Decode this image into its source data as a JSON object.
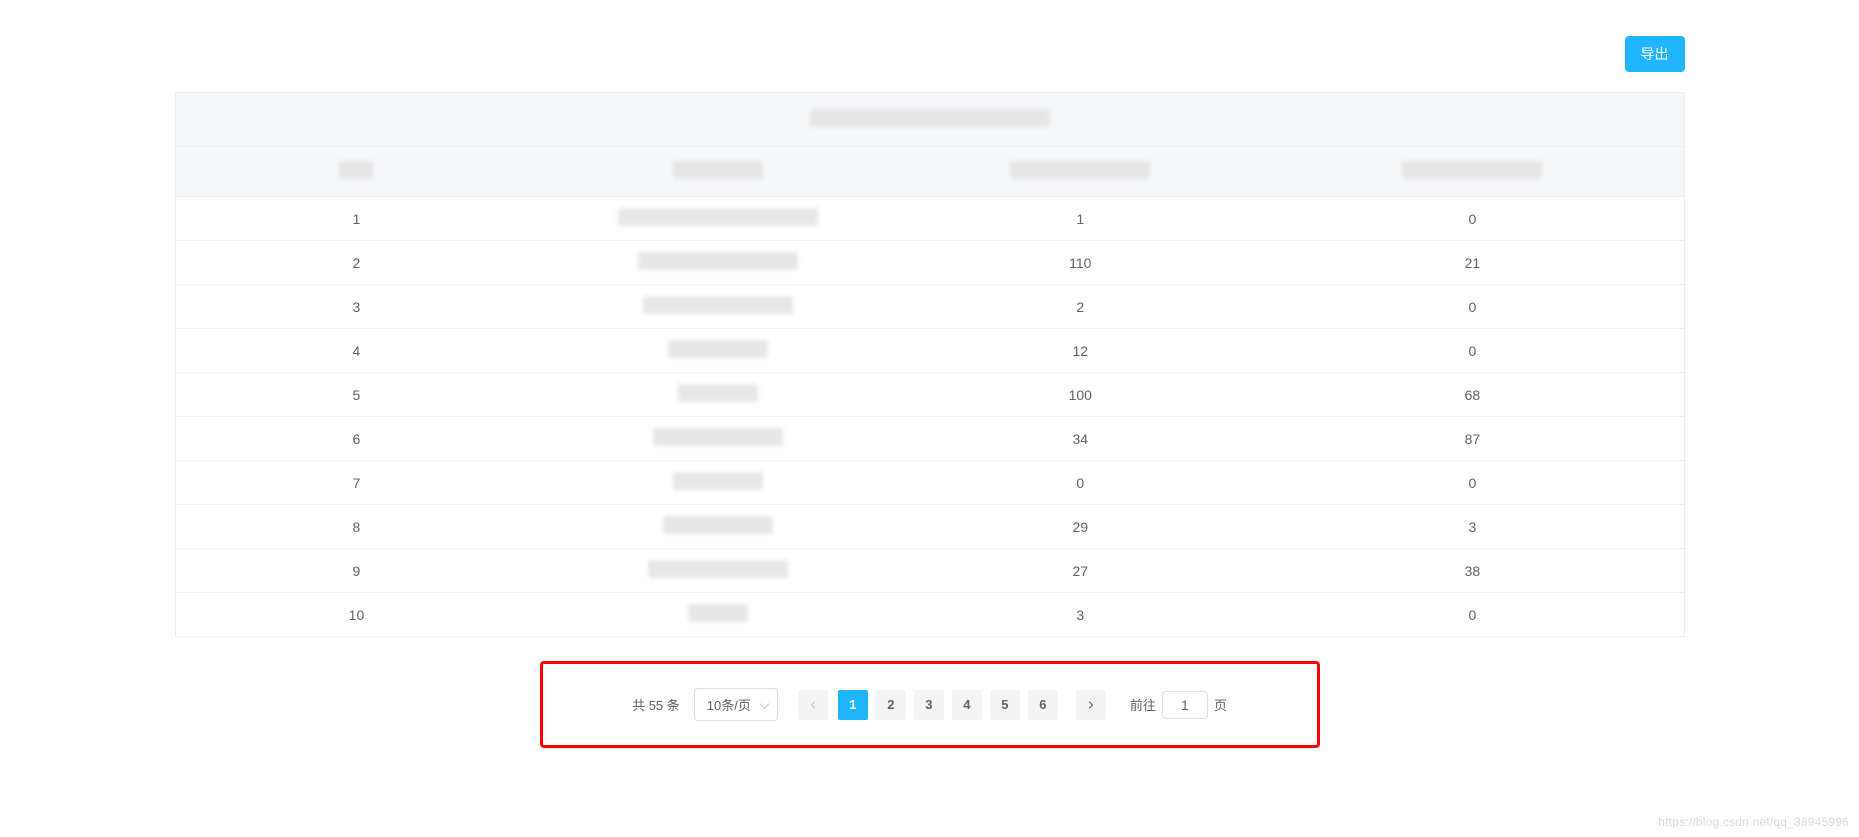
{
  "toolbar": {
    "export_label": "导出"
  },
  "table": {
    "title_blur_width": 240,
    "headers": [
      {
        "blur_width": 34
      },
      {
        "blur_width": 90
      },
      {
        "blur_width": 140
      },
      {
        "blur_width": 140
      }
    ],
    "rows": [
      {
        "c1": "1",
        "c2_blur_width": 200,
        "c3": "1",
        "c4": "0"
      },
      {
        "c1": "2",
        "c2_blur_width": 160,
        "c3": "110",
        "c4": "21"
      },
      {
        "c1": "3",
        "c2_blur_width": 150,
        "c3": "2",
        "c4": "0"
      },
      {
        "c1": "4",
        "c2_blur_width": 100,
        "c3": "12",
        "c4": "0"
      },
      {
        "c1": "5",
        "c2_blur_width": 80,
        "c3": "100",
        "c4": "68"
      },
      {
        "c1": "6",
        "c2_blur_width": 130,
        "c3": "34",
        "c4": "87"
      },
      {
        "c1": "7",
        "c2_blur_width": 90,
        "c3": "0",
        "c4": "0"
      },
      {
        "c1": "8",
        "c2_blur_width": 110,
        "c3": "29",
        "c4": "3"
      },
      {
        "c1": "9",
        "c2_blur_width": 140,
        "c3": "27",
        "c4": "38"
      },
      {
        "c1": "10",
        "c2_blur_width": 60,
        "c3": "3",
        "c4": "0"
      }
    ]
  },
  "pagination": {
    "total_text": "共 55 条",
    "page_size_label": "10条/页",
    "pages": [
      "1",
      "2",
      "3",
      "4",
      "5",
      "6"
    ],
    "active_page": "1",
    "jump_prefix": "前往",
    "jump_value": "1",
    "jump_suffix": "页"
  },
  "watermark": "https://blog.csdn.net/qq_38945996"
}
